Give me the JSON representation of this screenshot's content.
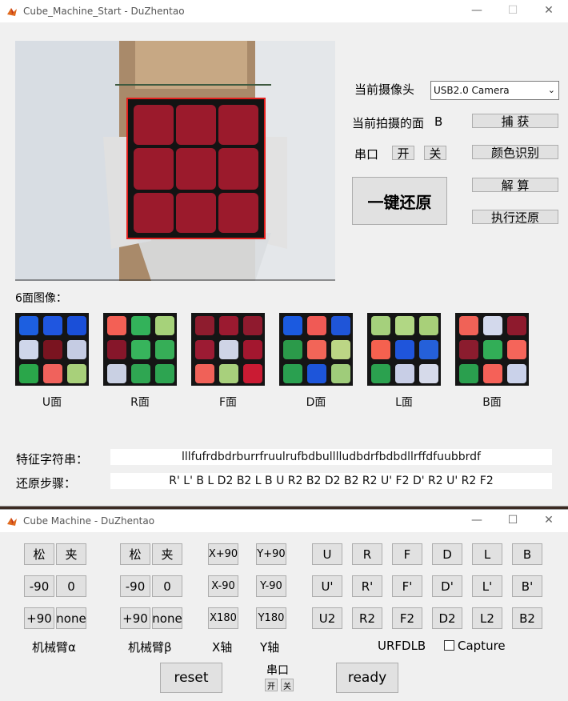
{
  "window1": {
    "title": "Cube_Machine_Start - DuZhentao",
    "camera_label": "当前摄像头",
    "camera_select": "USB2.0 Camera",
    "current_face_label": "当前拍摄的面",
    "current_face_value": "B",
    "capture_button": "捕 获",
    "serial_label": "串口",
    "serial_open": "开",
    "serial_close": "关",
    "color_recognition_button": "颜色识别",
    "one_key_restore_button": "一键还原",
    "solve_button": "解 算",
    "execute_restore_button": "执行还原",
    "six_faces_label": "6面图像：",
    "faces": [
      {
        "label": "U面",
        "colors": [
          "#1d5fe0",
          "#1f56e0",
          "#1a4fd8",
          "#cfd6ea",
          "#7a1420",
          "#c5cce3",
          "#2aa64a",
          "#f0625c",
          "#a8d07a"
        ]
      },
      {
        "label": "R面",
        "colors": [
          "#f36055",
          "#33b25a",
          "#a6d27a",
          "#86162a",
          "#37b45c",
          "#36ae57",
          "#c9d0e3",
          "#2fa652",
          "#2da451"
        ]
      },
      {
        "label": "F面",
        "colors": [
          "#8e1c2e",
          "#9b1a30",
          "#8f1a2e",
          "#9c1b33",
          "#cfd4e6",
          "#a3172f",
          "#f06158",
          "#a8d07c",
          "#ca1b33"
        ]
      },
      {
        "label": "D面",
        "colors": [
          "#1b5ae0",
          "#f05a55",
          "#1f55d8",
          "#2b9a4a",
          "#f26558",
          "#bcd685",
          "#2aa050",
          "#1d55da",
          "#9fcc7a"
        ]
      },
      {
        "label": "L面",
        "colors": [
          "#a5d07c",
          "#b1d784",
          "#a8d079",
          "#f5614f",
          "#1f55db",
          "#2560d9",
          "#2ba14f",
          "#c8cee6",
          "#d6daea"
        ]
      },
      {
        "label": "B面",
        "colors": [
          "#f06257",
          "#d3d9ec",
          "#8e1a2d",
          "#8b1c2e",
          "#32ae57",
          "#f5655a",
          "#2a9f4e",
          "#f56158",
          "#cad2ea"
        ]
      }
    ],
    "feature_label": "特征字符串：",
    "feature_value": "lllfufrdbdrburrfruulrufbdbulllludbdrfbdbdllrffdfuubbrdf",
    "steps_label": "还原步骤：",
    "steps_value": "R' L' B L D2 B2 L B U R2 B2 D2 B2 R2 U' F2 D' R2 U' R2 F2",
    "camera_preview_colors": {
      "sticker": "#9b1a2c",
      "box": "#e3201e"
    }
  },
  "window2": {
    "title": "Cube Machine - DuZhentao",
    "arm_alpha": {
      "loosen": "松",
      "clamp": "夹",
      "minus90": "-90",
      "zero": "0",
      "plus90": "+90",
      "none": "none",
      "label": "机械臂α"
    },
    "arm_beta": {
      "loosen": "松",
      "clamp": "夹",
      "minus90": "-90",
      "zero": "0",
      "plus90": "+90",
      "none": "none",
      "label": "机械臂β"
    },
    "x_axis": {
      "plus90": "X+90",
      "minus90": "X-90",
      "r180": "X180",
      "label": "X轴"
    },
    "y_axis": {
      "plus90": "Y+90",
      "minus90": "Y-90",
      "r180": "Y180",
      "label": "Y轴"
    },
    "moves_row1": [
      "U",
      "R",
      "F",
      "D",
      "L",
      "B"
    ],
    "moves_row2": [
      "U'",
      "R'",
      "F'",
      "D'",
      "L'",
      "B'"
    ],
    "moves_row3": [
      "U2",
      "R2",
      "F2",
      "D2",
      "L2",
      "B2"
    ],
    "urfdlb_label": "URFDLB",
    "capture_checkbox": "Capture",
    "reset_button": "reset",
    "serial_label": "串口",
    "serial_open": "开",
    "serial_close": "关",
    "ready_button": "ready"
  }
}
